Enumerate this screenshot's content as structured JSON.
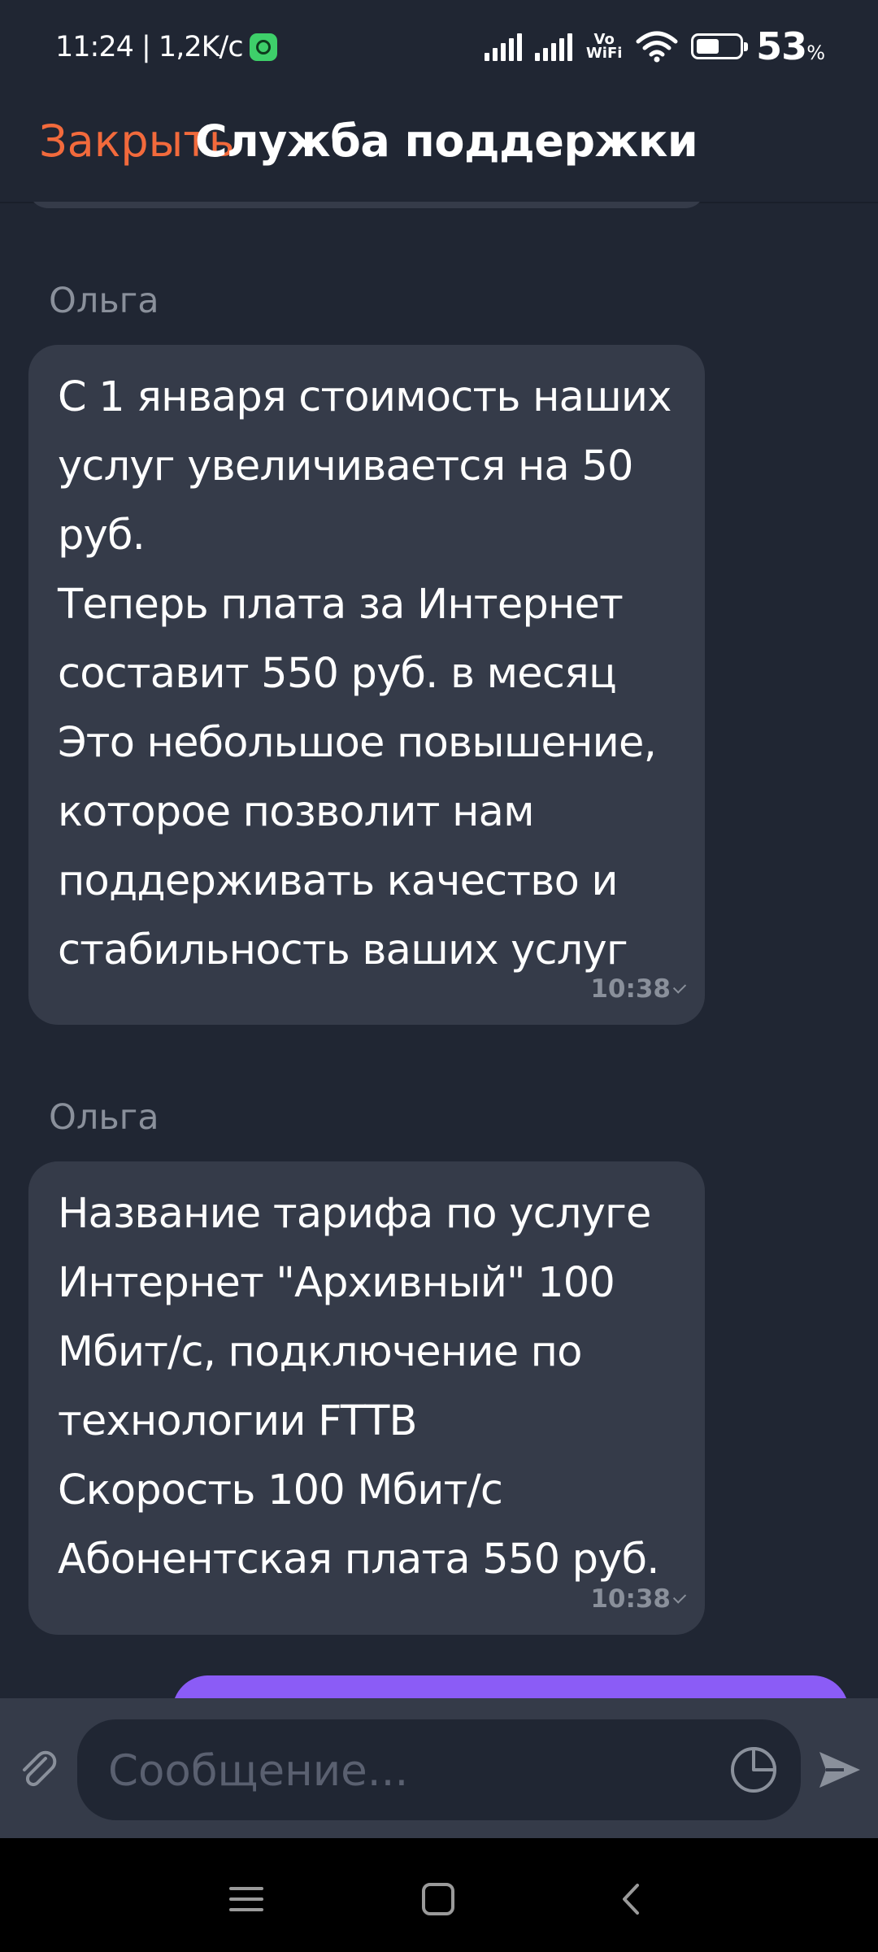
{
  "status_bar": {
    "time": "11:24",
    "network_speed": "1,2K/с",
    "vowifi_line1": "Vo",
    "vowifi_line2": "WiFi",
    "battery_level": 0.53,
    "battery_percent": "53",
    "battery_unit": "%"
  },
  "header": {
    "close_label": "Закрыть",
    "title": "Служба поддержки"
  },
  "messages": [
    {
      "sender": "Ольга",
      "text": "С 1 января стоимость наших\nуслуг увеличивается на 50\nруб.\nТеперь плата за Интернет\nсоставит 550 руб. в месяц\nЭто небольшое повышение,\nкоторое позволит нам\nподдерживать качество и\nстабильность ваших услуг",
      "time": "10:38"
    },
    {
      "sender": "Ольга",
      "text": "Название тарифа по услуге\nИнтернет \"Архивный\" 100\nМбит/с, подключение по\nтехнологии FTTB\nСкорость 100 Мбит/с\nАбонентская плата 550 руб.",
      "time": "10:38"
    }
  ],
  "composer": {
    "placeholder": "Сообщение...",
    "attach_icon": "paperclip-icon",
    "sticker_icon": "sticker-icon",
    "send_icon": "send-icon"
  },
  "nav_bar": {
    "icons": [
      "menu-icon",
      "home-icon",
      "back-icon"
    ]
  },
  "colors": {
    "background": "#202633",
    "bubble": "#353b49",
    "accent_close": "#f26a3c",
    "outgoing_bubble": "#8b5cf6",
    "meta_text": "#8a909b"
  }
}
